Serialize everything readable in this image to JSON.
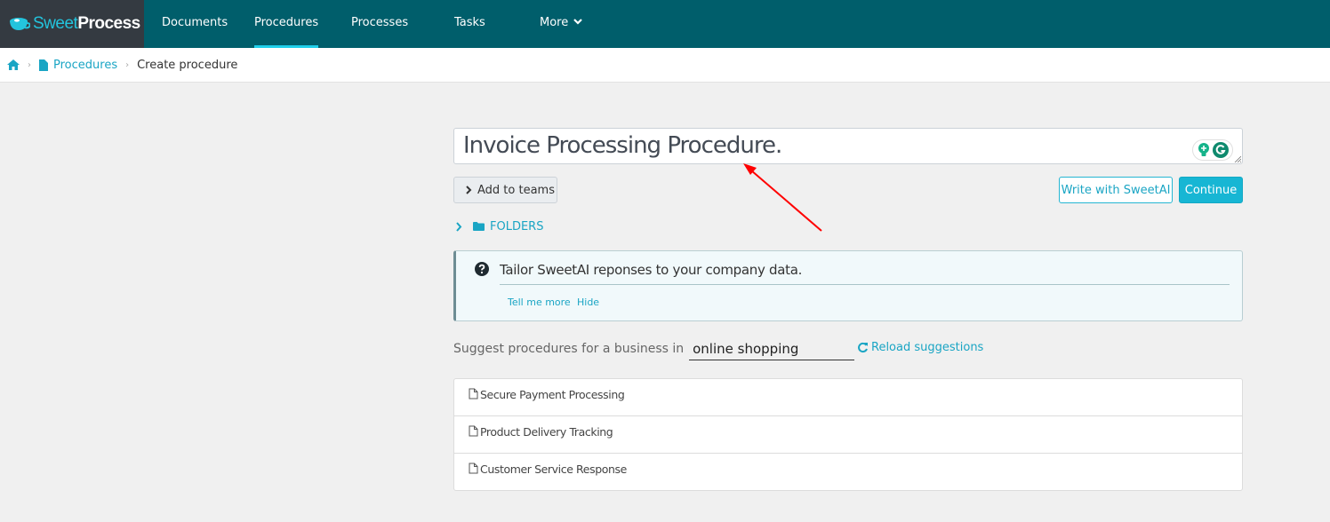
{
  "brand": {
    "sweet": "Sweet",
    "process": "Process"
  },
  "nav": {
    "items": [
      {
        "label": "Documents",
        "active": false
      },
      {
        "label": "Procedures",
        "active": true
      },
      {
        "label": "Processes",
        "active": false
      },
      {
        "label": "Tasks",
        "active": false
      },
      {
        "label": "More",
        "active": false,
        "icon": "chevron-down-icon"
      }
    ]
  },
  "breadcrumb": {
    "home_icon": "home-icon",
    "items": [
      {
        "label": "Procedures",
        "icon": "file-icon",
        "link": true
      },
      {
        "label": "Create procedure",
        "link": false
      }
    ]
  },
  "form": {
    "title_value": "Invoice Processing Procedure.",
    "add_teams_label": "Add to teams",
    "write_ai_label": "Write with SweetAI",
    "continue_label": "Continue",
    "folders_label": "FOLDERS"
  },
  "info": {
    "message": "Tailor SweetAI reponses to your company data.",
    "tell_more": "Tell me more",
    "hide": "Hide"
  },
  "suggest": {
    "label": "Suggest procedures for a business in",
    "business_value": "online shopping",
    "reload_label": "Reload suggestions",
    "items": [
      "Secure Payment Processing",
      "Product Delivery Tracking",
      "Customer Service Response"
    ]
  },
  "colors": {
    "nav_bg": "#005e6b",
    "brand_bg": "#343a41",
    "accent": "#17b6d4",
    "annotation_arrow": "#ff0000"
  }
}
